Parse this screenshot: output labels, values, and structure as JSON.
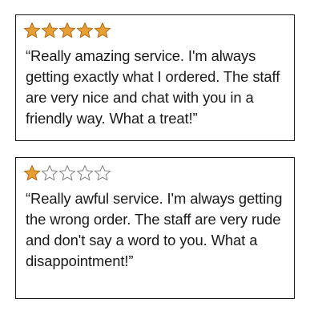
{
  "reviews": [
    {
      "rating": 5,
      "max_rating": 5,
      "text": "“Really amazing service. I'm always getting exactly what I ordered. The staff are very nice and chat with you in a friendly way. What a treat!”"
    },
    {
      "rating": 1,
      "max_rating": 5,
      "text": "“Really awful service. I'm always getting the wrong order. The staff are very rude and don't say a word to you. What a disappointment!”"
    }
  ],
  "colors": {
    "star_filled": "#e8a035",
    "star_filled_stroke": "#b5701c",
    "star_empty_stroke": "#8a8a8a",
    "border": "#1a1a1a",
    "text": "#1a1a1a"
  },
  "icons": {
    "filled_star": "star-filled-icon",
    "empty_star": "star-empty-icon"
  }
}
